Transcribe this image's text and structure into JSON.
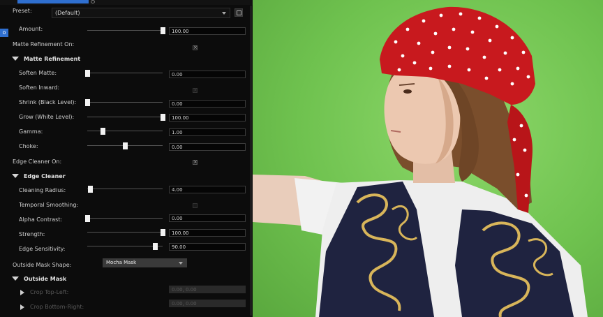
{
  "preset": {
    "label": "Preset:",
    "value": "(Default)"
  },
  "left_tab": "o",
  "amount": {
    "label": "Amount:",
    "value": "100.00",
    "level": 1.0
  },
  "matte_refinement_on": {
    "label": "Matte Refinement On:",
    "checked": true
  },
  "matte_refinement": {
    "title": "Matte Refinement",
    "soften_matte": {
      "label": "Soften Matte:",
      "value": "0.00",
      "level": 0.0
    },
    "soften_inward": {
      "label": "Soften Inward:"
    },
    "shrink": {
      "label": "Shrink (Black Level):",
      "value": "0.00",
      "level": 0.0
    },
    "grow": {
      "label": "Grow (White Level):",
      "value": "100.00",
      "level": 1.0
    },
    "gamma": {
      "label": "Gamma:",
      "value": "1.00",
      "level": 0.2
    },
    "choke": {
      "label": "Choke:",
      "value": "0.00",
      "level": 0.5
    }
  },
  "edge_cleaner_on": {
    "label": "Edge Cleaner On:",
    "checked": true
  },
  "edge_cleaner": {
    "title": "Edge Cleaner",
    "cleaning_radius": {
      "label": "Cleaning Radius:",
      "value": "4.00",
      "level": 0.04
    },
    "temporal_smoothing": {
      "label": "Temporal Smoothing:",
      "checked": false
    },
    "alpha_contrast": {
      "label": "Alpha Contrast:",
      "value": "0.00",
      "level": 0.0
    },
    "strength": {
      "label": "Strength:",
      "value": "100.00",
      "level": 1.0
    },
    "edge_sensitivity": {
      "label": "Edge Sensitivity:",
      "value": "90.00",
      "level": 0.9
    }
  },
  "outside_mask_shape": {
    "label": "Outside Mask Shape:",
    "value": "Mocha Mask"
  },
  "outside_mask": {
    "title": "Outside Mask",
    "crop_top_left": {
      "label": "Crop Top-Left:",
      "value": "0.00, 0.00"
    },
    "crop_bottom_right": {
      "label": "Crop Bottom-Right:",
      "value": "0.00, 0.00"
    }
  },
  "colors": {
    "accent": "#2f6fcf",
    "green_screen": "#7cc95a",
    "bandana": "#c8191e"
  }
}
